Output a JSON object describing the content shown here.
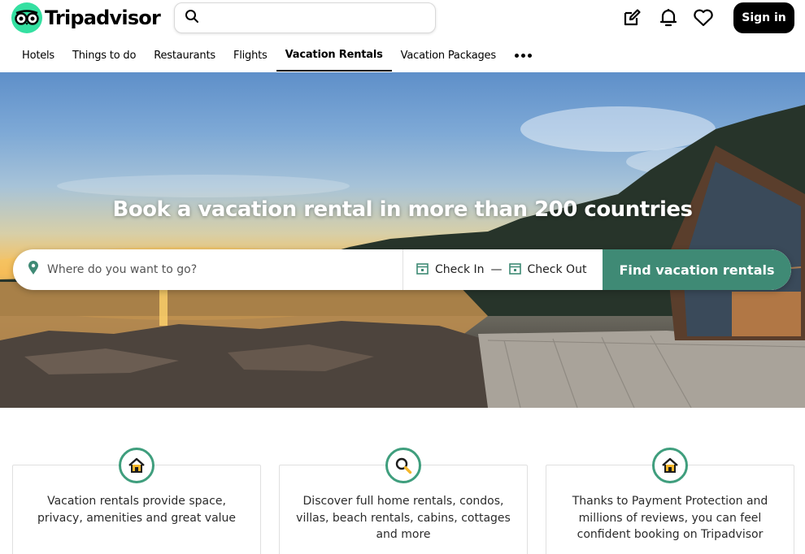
{
  "header": {
    "brand": "Tripadvisor",
    "search_placeholder": "",
    "signin_label": "Sign in",
    "icons": [
      "edit-icon",
      "bell-icon",
      "heart-icon"
    ]
  },
  "nav": {
    "items": [
      {
        "label": "Hotels",
        "active": false
      },
      {
        "label": "Things to do",
        "active": false
      },
      {
        "label": "Restaurants",
        "active": false
      },
      {
        "label": "Flights",
        "active": false
      },
      {
        "label": "Vacation Rentals",
        "active": true
      },
      {
        "label": "Vacation Packages",
        "active": false
      }
    ],
    "more_icon": "more-dots-icon"
  },
  "hero": {
    "title": "Book a vacation rental in more than 200 countries",
    "where_placeholder": "Where do you want to go?",
    "check_in": "Check In",
    "separator": "—",
    "check_out": "Check Out",
    "button": "Find vacation rentals"
  },
  "features": [
    {
      "icon": "house-icon",
      "text": "Vacation rentals provide space, privacy, amenities and great value"
    },
    {
      "icon": "magnifier-icon",
      "text": "Discover full home rentals, condos, villas, beach rentals, cabins, cottages and more"
    },
    {
      "icon": "house-icon",
      "text": "Thanks to Payment Protection and millions of reviews, you can feel confident booking on Tripadvisor"
    }
  ],
  "colors": {
    "brand_green": "#34e0a1",
    "button_green": "#3f8a75",
    "icon_ring": "#3f9e7d",
    "black": "#000000"
  }
}
